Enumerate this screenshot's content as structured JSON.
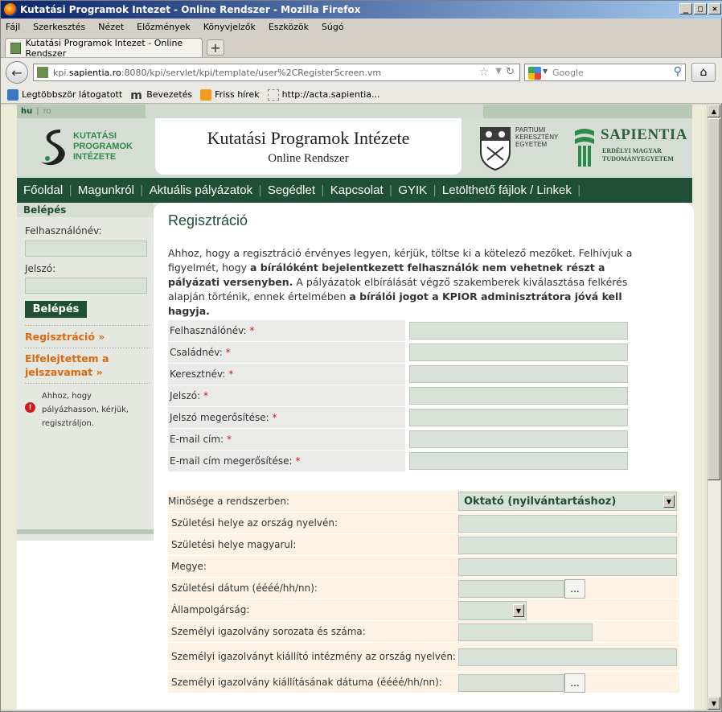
{
  "browser": {
    "window_title": "Kutatási Programok Intezet - Online Rendszer - Mozilla Firefox",
    "menu": [
      "Fájl",
      "Szerkesztés",
      "Nézet",
      "Előzmények",
      "Könyvjelzők",
      "Eszközök",
      "Súgó"
    ],
    "tab_title": "Kutatási Programok Intezet - Online Rendszer",
    "url_prefix": "kpi.",
    "url_domain": "sapientia.ro",
    "url_rest": ":8080/kpi/servlet/kpi/template/user%2CRegisterScreen.vm",
    "search_placeholder": "Google",
    "bookmarks": [
      "Legtöbbször látogatott",
      "Bevezetés",
      "Friss hírek",
      "http://acta.sapientia..."
    ]
  },
  "site": {
    "lang_hu": "hu",
    "lang_sep": "|",
    "lang_ro": "ro",
    "kpi_logo_lines": [
      "KUTATÁSI",
      "PROGRAMOK",
      "INTÉZETE"
    ],
    "title": "Kutatási Programok Intézete",
    "subtitle": "Online Rendszer",
    "pke_lines": [
      "PARTIUMI",
      "KERESZTÉNY",
      "EGYETEM"
    ],
    "sapientia": "SAPIENTIA",
    "sapientia_sub": [
      "ERDÉLYI MAGYAR",
      "TUDOMÁNYEGYETEM"
    ],
    "nav": [
      "Főoldal",
      "Magunkról",
      "Aktuális pályázatok",
      "Segédlet",
      "Kapcsolat",
      "GYIK",
      "Letölthető fájlok / Linkek"
    ]
  },
  "sidebar": {
    "heading": "Belépés",
    "username_label": "Felhasználónév:",
    "password_label": "Jelszó:",
    "login_button": "Belépés",
    "register_link": "Regisztráció »",
    "forgot_link": "Elfelejtettem a jelszavamat »",
    "info": "Ahhoz, hogy pályázhasson, kérjük, regisztráljon."
  },
  "content": {
    "title": "Regisztráció",
    "intro_1": "Ahhoz, hogy a regisztráció érvényes legyen, kérjük, töltse ki a kötelező mezőket. Felhívjuk a figyelmét, hogy ",
    "intro_bold_1": "a bírálóként bejelentkezett felhasználók nem vehetnek részt a pályázati versenyben.",
    "intro_2": " A pályázatok elbírálását végző szakemberek kiválasztása felkérés alapján történik, ennek értelmében ",
    "intro_bold_2": "a bírálói jogot a KPIOR adminisztrátora jóvá kell hagyja.",
    "required_mark": "*",
    "form1": [
      "Felhasználónév:",
      "Családnév:",
      "Keresztnév:",
      "Jelszó:",
      "Jelszó megerősítése:",
      "E-mail cím:",
      "E-mail cím megerősítése:"
    ],
    "role_label": "Minősége a rendszerben:",
    "role_value": "Oktató (nyilvántartáshoz)",
    "form2": {
      "birthplace_native": "Születési helye az ország nyelvén:",
      "birthplace_hu": "Születési helye magyarul:",
      "county": "Megye:",
      "birthdate": "Születési dátum (éééé/hh/nn):",
      "citizenship": "Állampolgárság:",
      "id_series": "Személyi igazolvány sorozata és száma:",
      "id_issuer": "Személyi igazolványt kiállító intézmény az ország nyelvén:",
      "id_issue_date": "Személyi igazolvány kiállításának dátuma (éééé/hh/nn):"
    },
    "dots_button": "..."
  }
}
